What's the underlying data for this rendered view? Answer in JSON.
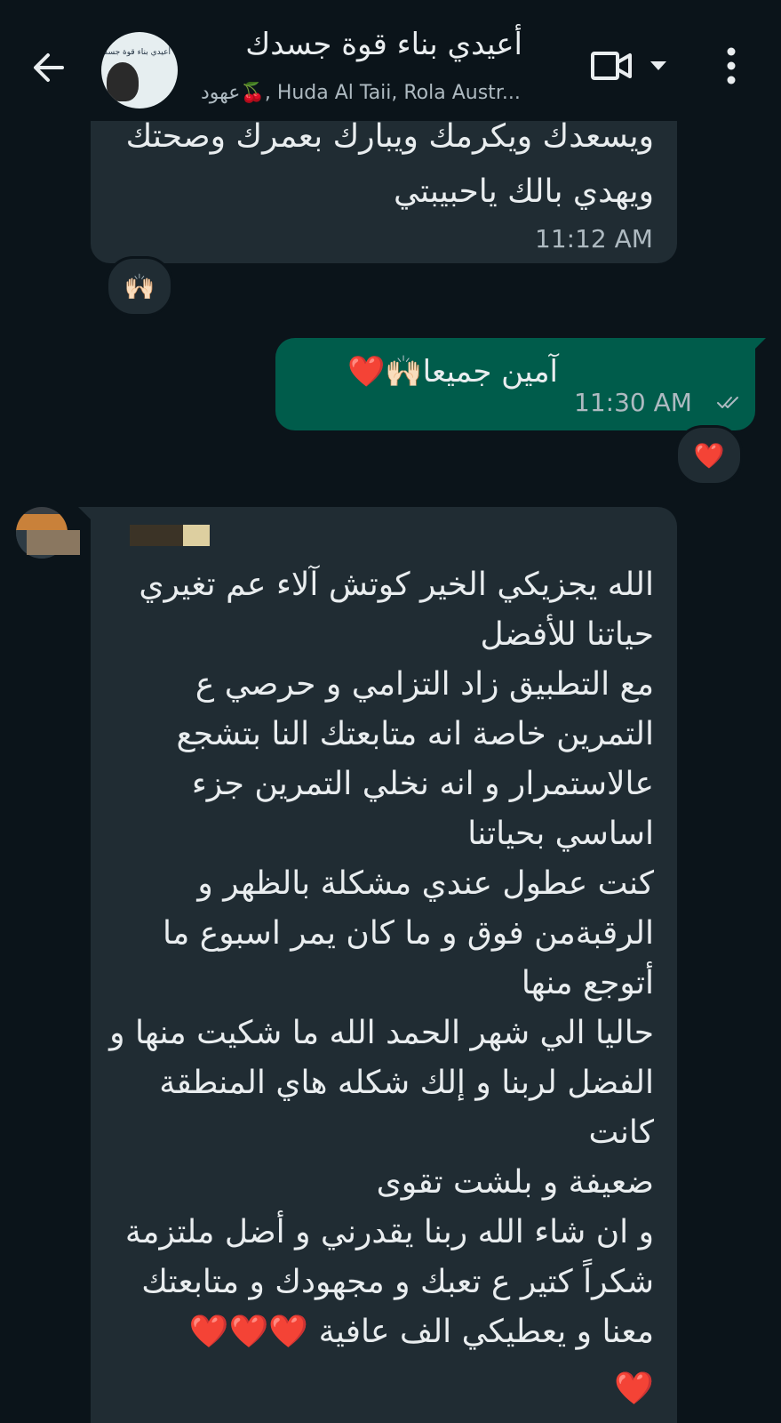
{
  "header": {
    "title": "أعيدي بناء قوة جسدك",
    "subtitle": "عهود🍒, Huda Al Taii, Rola Austr...",
    "avatar_text": "أعيدي بناء قوة جسدك"
  },
  "messages": {
    "first": {
      "lines": [
        "ويسعدك ويكرمك ويبارك بعمرك وصحتك",
        "ويهدي بالك ياحبيبتي"
      ],
      "time": "11:12 AM",
      "reaction": "🙌🏻"
    },
    "outgoing": {
      "text": "آمين جميعا🙌🏻❤️",
      "time": "11:30 AM",
      "reaction": "❤️"
    },
    "long": {
      "lines": [
        "الله يجزيكي الخير كوتش آلاء عم تغيري",
        "حياتنا للأفضل",
        "مع التطبيق زاد التزامي و حرصي ع",
        "التمرين خاصة انه متابعتك النا بتشجع",
        "عالاستمرار و انه نخلي التمرين جزء",
        "اساسي بحياتنا",
        "كنت عطول عندي مشكلة بالظهر و",
        "الرقبةمن فوق و ما كان يمر اسبوع ما",
        "أتوجع منها",
        "حاليا الي شهر الحمد الله ما شكيت منها و",
        "الفضل لربنا و إلك شكله هاي المنطقة كانت",
        "ضعيفة و بلشت تقوى",
        "و ان شاء الله ربنا يقدرني و أضل ملتزمة",
        "شكراً كتير ع تعبك و مجهودك و متابعتك",
        "معنا و يعطيكي الف عافية ❤️❤️❤️",
        "❤️"
      ]
    }
  },
  "colors": {
    "background": "#0b141a",
    "incoming": "#202c33",
    "outgoing": "#005c4b"
  },
  "icons": [
    "back-arrow-icon",
    "video-call-icon",
    "chevron-down-icon",
    "more-options-icon",
    "read-receipt-icon"
  ]
}
